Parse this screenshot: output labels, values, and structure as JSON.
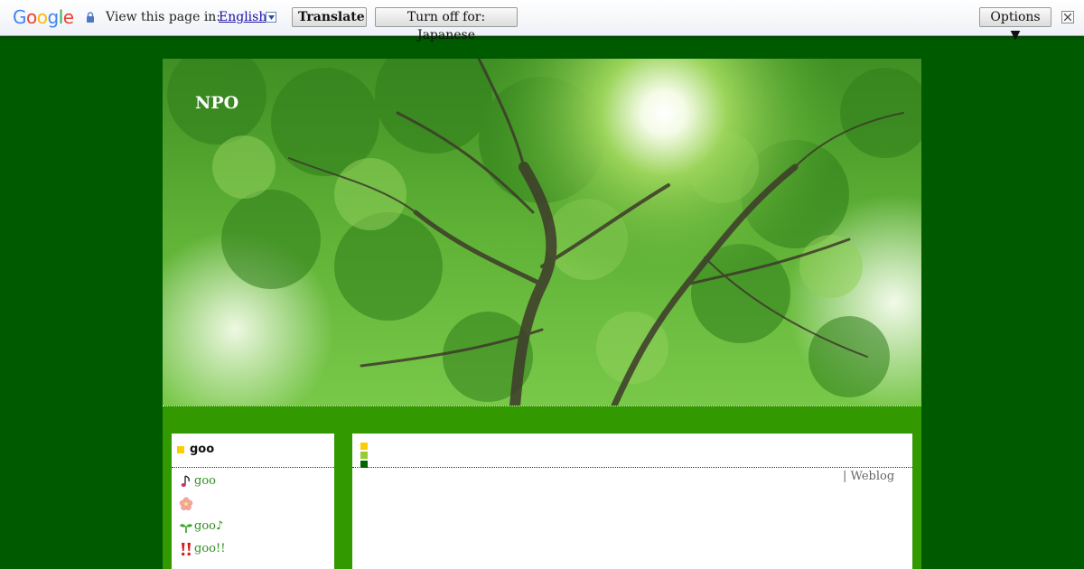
{
  "translate_bar": {
    "logo": "Google",
    "prompt": "View this page in:",
    "language": "English",
    "translate_button": "Translate",
    "turn_off_button": "Turn off for: Japanese",
    "options_button": "Options ▼"
  },
  "site": {
    "title": "NPO"
  },
  "sidebar": {
    "title": "goo",
    "items": [
      {
        "icon": "music-note-icon",
        "label": "goo"
      },
      {
        "icon": "flower-icon",
        "label": ""
      },
      {
        "icon": "sprout-icon",
        "label": "goo♪"
      },
      {
        "icon": "double-exclamation-icon",
        "label": "goo!!"
      }
    ]
  },
  "main": {
    "title": "",
    "footer_link": "| Weblog"
  },
  "colors": {
    "background": "#005a00",
    "frame": "#339900",
    "link": "#2f8f1f",
    "square_yellow": "#ffcc00",
    "square_light_green": "#99cc33",
    "square_dark_green": "#006600"
  }
}
